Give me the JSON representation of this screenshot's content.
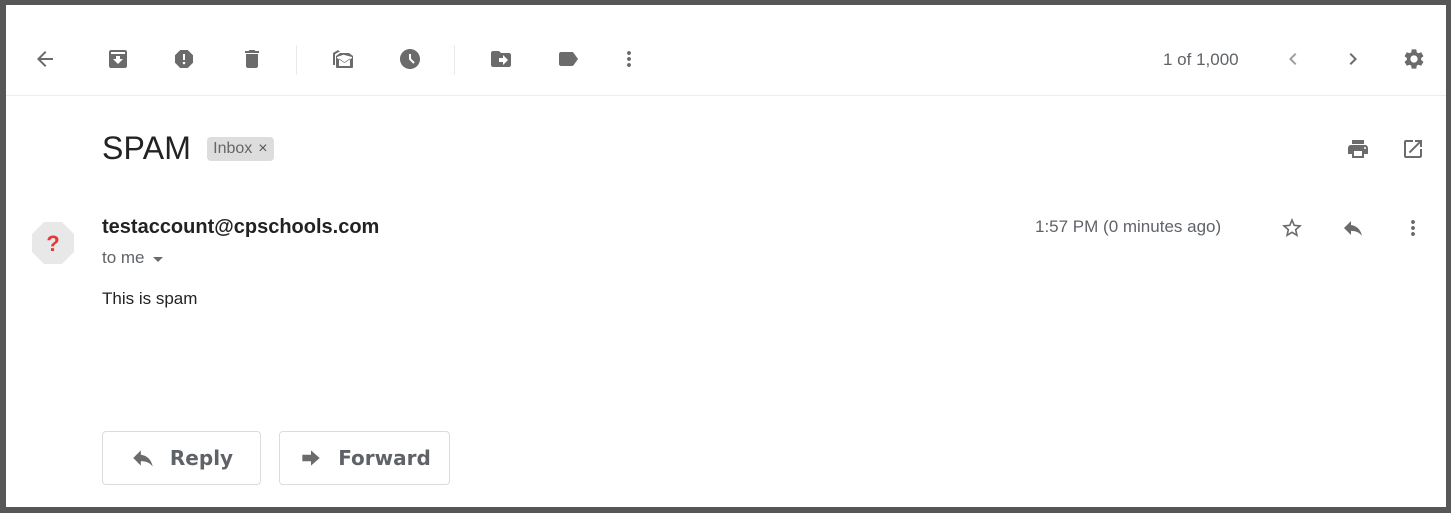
{
  "toolbar": {
    "icons": [
      {
        "name": "back-icon",
        "label": "Back"
      },
      {
        "name": "archive-icon",
        "label": "Archive"
      },
      {
        "name": "report-spam-icon",
        "label": "Report spam"
      },
      {
        "name": "delete-icon",
        "label": "Delete"
      },
      {
        "name": "mark-unread-icon",
        "label": "Mark as unread"
      },
      {
        "name": "snooze-icon",
        "label": "Snooze"
      },
      {
        "name": "move-to-icon",
        "label": "Move to"
      },
      {
        "name": "label-icon",
        "label": "Labels"
      },
      {
        "name": "more-vert-icon",
        "label": "More"
      }
    ],
    "pager_text": "1 of 1,000",
    "prev_label": "Newer",
    "next_label": "Older",
    "settings_label": "Settings"
  },
  "message": {
    "subject": "SPAM",
    "label_chip": "Inbox",
    "label_remove": "×",
    "print_label": "Print all",
    "open_new_window_label": "In new window",
    "sender": "testaccount@cpschools.com",
    "recipient": "to me",
    "timestamp": "1:57 PM (0 minutes ago)",
    "body": "This is spam",
    "avatar_glyph": "?",
    "avatar_color": "#e53935"
  },
  "actions": {
    "reply_label": "Reply",
    "forward_label": "Forward"
  }
}
